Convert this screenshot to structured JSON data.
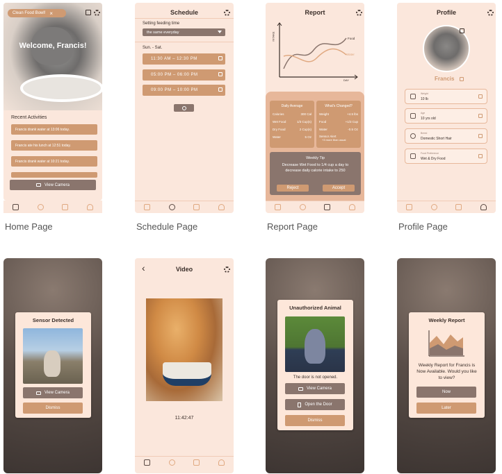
{
  "captions": {
    "home": "Home Page",
    "schedule": "Schedule Page",
    "report": "Report Page",
    "profile": "Profile Page"
  },
  "home": {
    "tag": "Clean Food Bowl!",
    "tag_close": "×",
    "welcome": "Welcome, Francis!",
    "section": "Recent Activities",
    "activities": [
      "Francis drank water at 13:06 today.",
      "Francis ate his lunch at 12:51 today.",
      "Francis drank water at 10:21 today."
    ],
    "view_camera": "View Camera"
  },
  "schedule": {
    "title": "Schedule",
    "setting_label": "Setting feeding time",
    "select_value": "the same everyday",
    "days": "Sun. - Sat.",
    "slots": [
      "11:30 AM – 12:30 PM",
      "05:00 PM – 06:00 PM",
      "09:00 PM – 10:00 PM"
    ]
  },
  "report": {
    "title": "Report",
    "ylabel": "INTAKE",
    "xlabel": "DAY",
    "series": [
      "Food",
      "Water"
    ],
    "daily_title": "Daily Average",
    "daily": [
      [
        "Calories",
        "300 Cal"
      ],
      [
        "Wet Food",
        "1/3 Cup(s)"
      ],
      [
        "Dry Food",
        "2 Cup(s)"
      ],
      [
        "Water",
        "5 Oz"
      ]
    ],
    "changed_title": "What's Changed?",
    "changed": [
      [
        "Weight",
        "+4.5 lbs"
      ],
      [
        "Food",
        "+1/3 Cup"
      ],
      [
        "Water",
        "-0.5 Oz"
      ]
    ],
    "sensor_alert": "Sensor Alert",
    "sensor_more": "+3 more than usual",
    "tip_title": "Weekly Tip",
    "tip_text": "Decrease Wet Food to 1/4 cup a day to decrease daily calorie intake to 250",
    "reject": "Reject",
    "accept": "Accept"
  },
  "profile": {
    "title": "Profile",
    "name": "Francis",
    "rows": [
      [
        "Weight",
        "10 lb"
      ],
      [
        "Age",
        "10 yrs old"
      ],
      [
        "Breed",
        "Domestic Short Hair"
      ],
      [
        "Food Preference",
        "Wet & Dry Food"
      ]
    ]
  },
  "sensor": {
    "title": "Sensor Detected",
    "view_camera": "View Camera",
    "dismiss": "Dismiss"
  },
  "video": {
    "title": "Video",
    "back": "‹",
    "time": "11:42:47"
  },
  "unauth": {
    "title": "Unauthorized Animal",
    "note": "The door is not opened.",
    "view_camera": "View Camera",
    "open_door": "Open the Door",
    "dismiss": "Dismiss"
  },
  "weekly": {
    "title": "Weekly Report",
    "text": "Weekly Report for Francis is Now Available. Would you like to view?",
    "now": "Now",
    "later": "Later"
  }
}
